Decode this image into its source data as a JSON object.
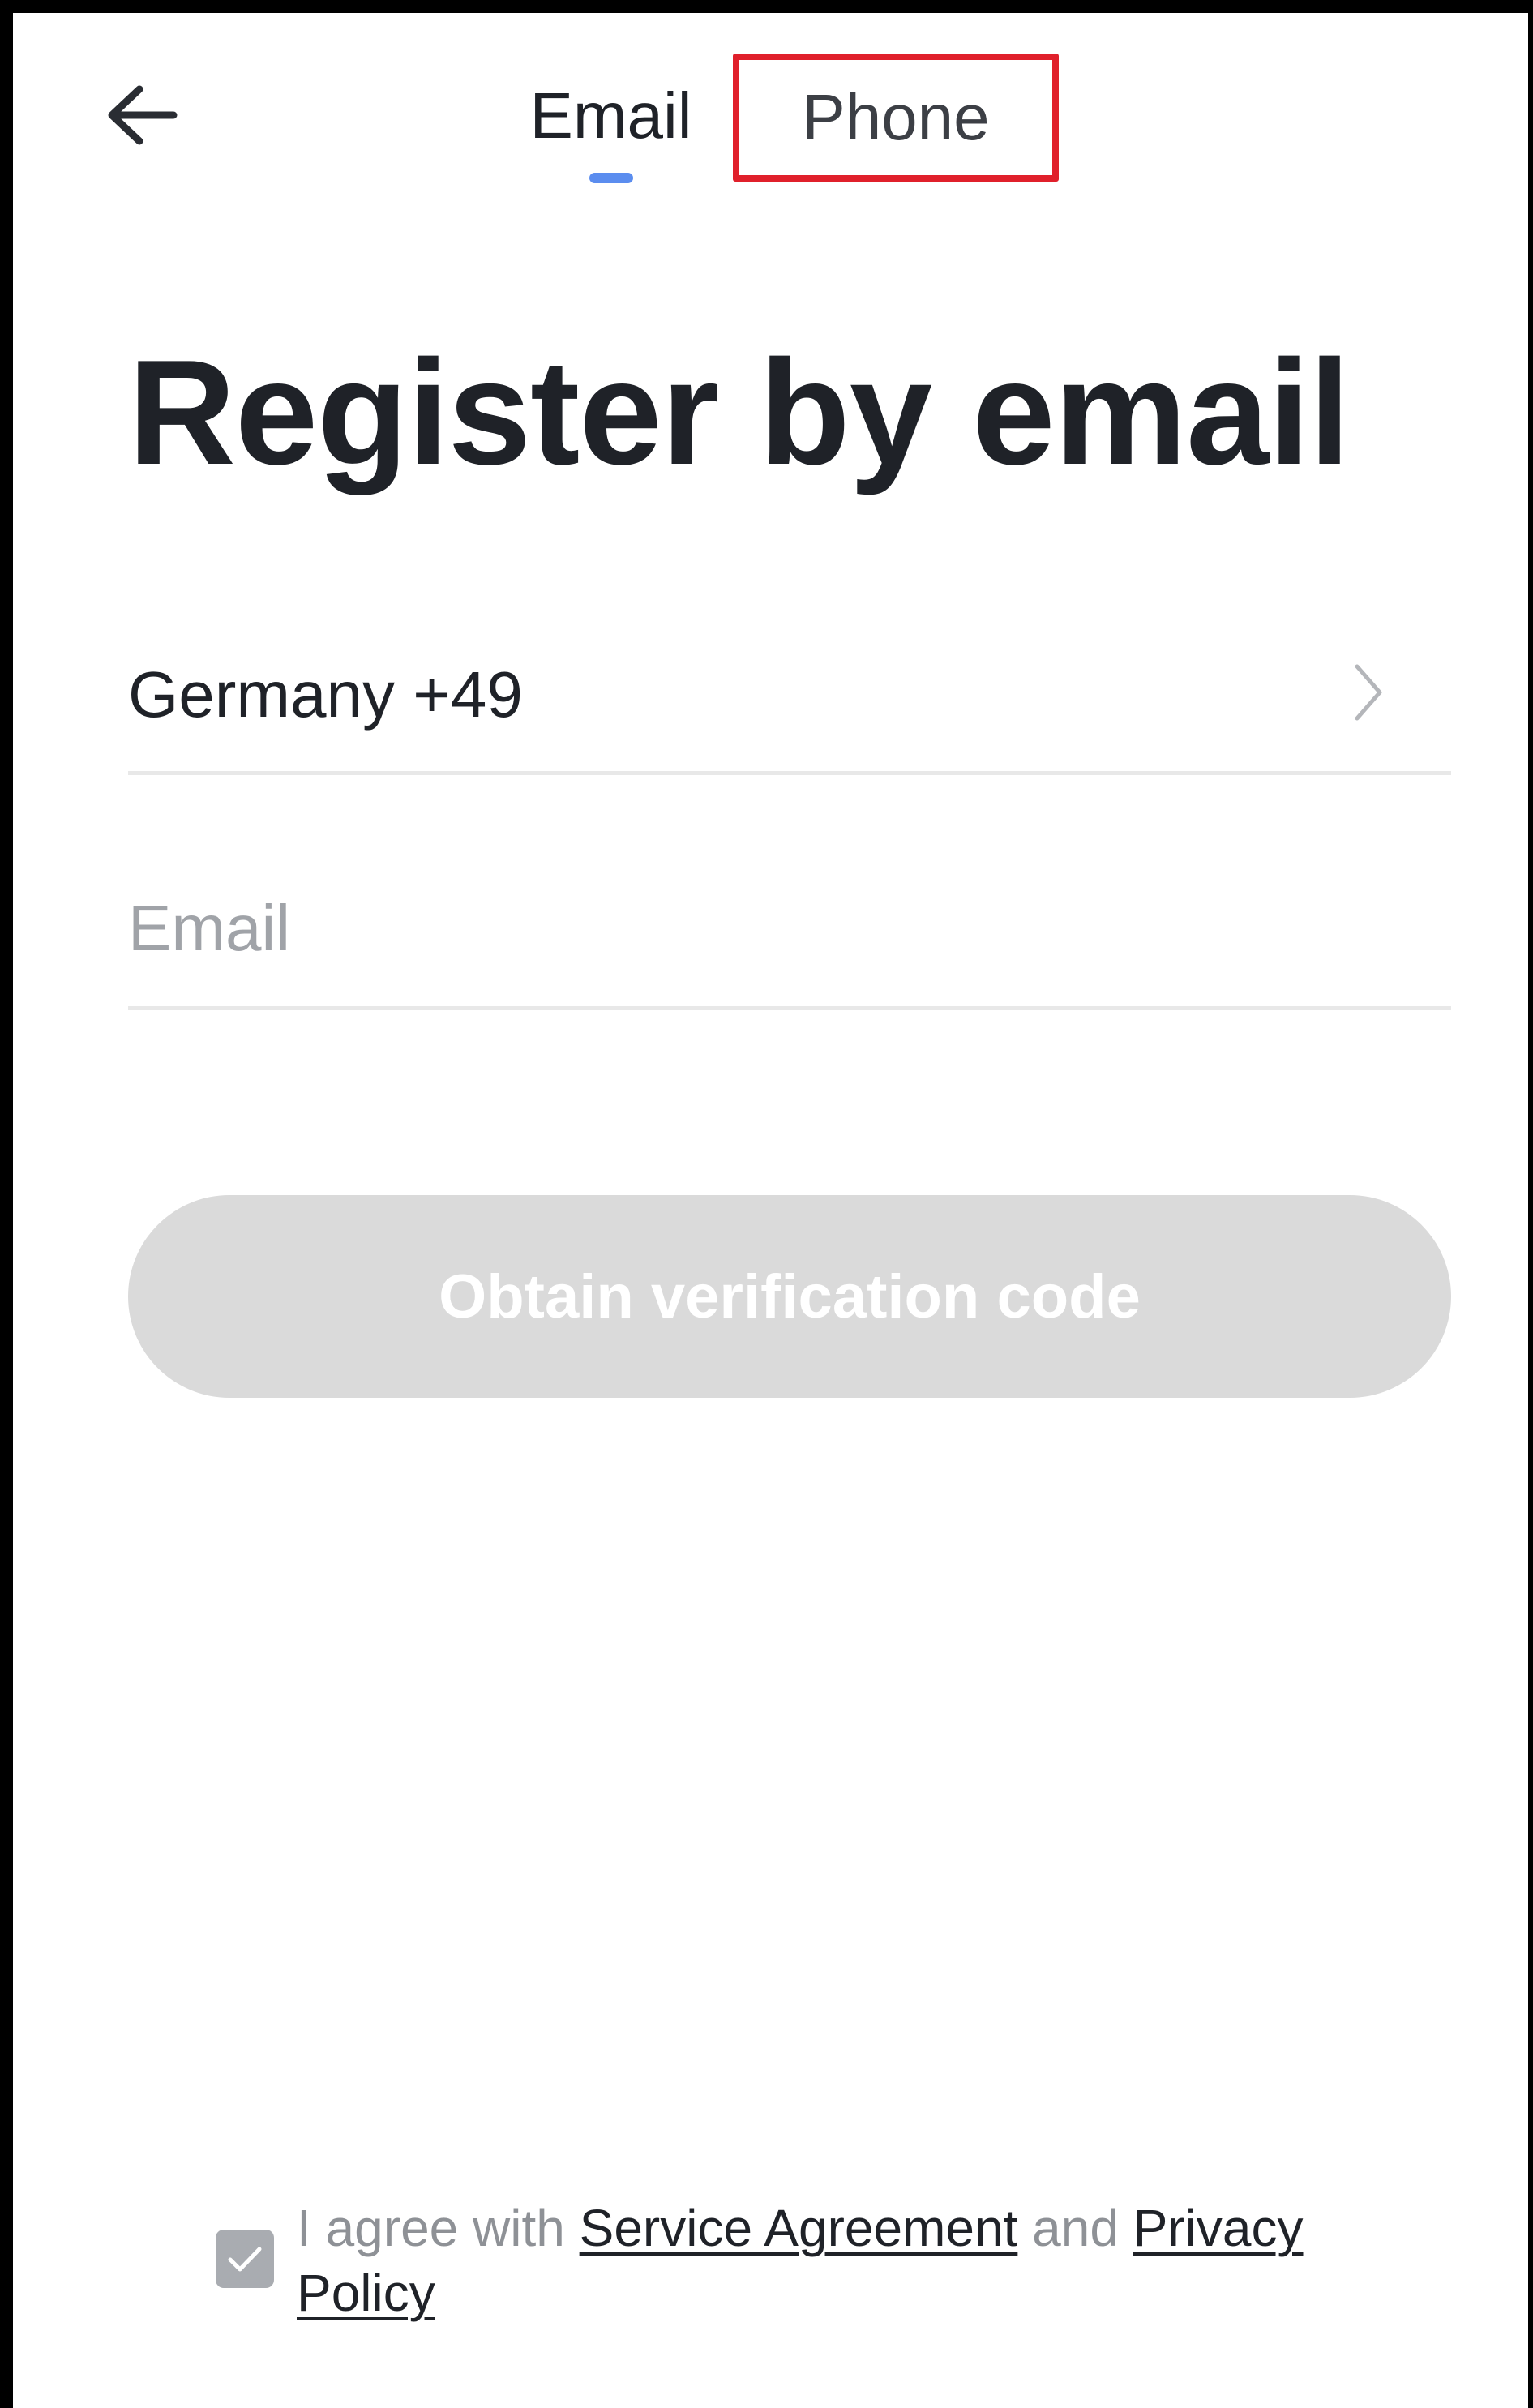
{
  "header": {
    "tabs": [
      {
        "label": "Email",
        "active": true
      },
      {
        "label": "Phone",
        "active": false
      }
    ],
    "highlight_color": "#e0202b",
    "indicator_color": "#5b8def"
  },
  "main": {
    "title": "Register by email",
    "country_selector": {
      "value": "Germany +49"
    },
    "email_field": {
      "value": "",
      "placeholder": "Email"
    },
    "submit_button": {
      "label": "Obtain verification code",
      "enabled": false,
      "color": "#dadada"
    }
  },
  "footer": {
    "agreement": {
      "checked": true,
      "checkbox_color": "#a9acb1",
      "prefix": "I agree with",
      "service_link": "Service Agreement",
      "connector": "and",
      "privacy_link": "Privacy Policy"
    }
  },
  "icons": {
    "back": "arrow-left-icon",
    "country_chevron": "chevron-right-icon",
    "checkbox": "checkmark-icon"
  }
}
